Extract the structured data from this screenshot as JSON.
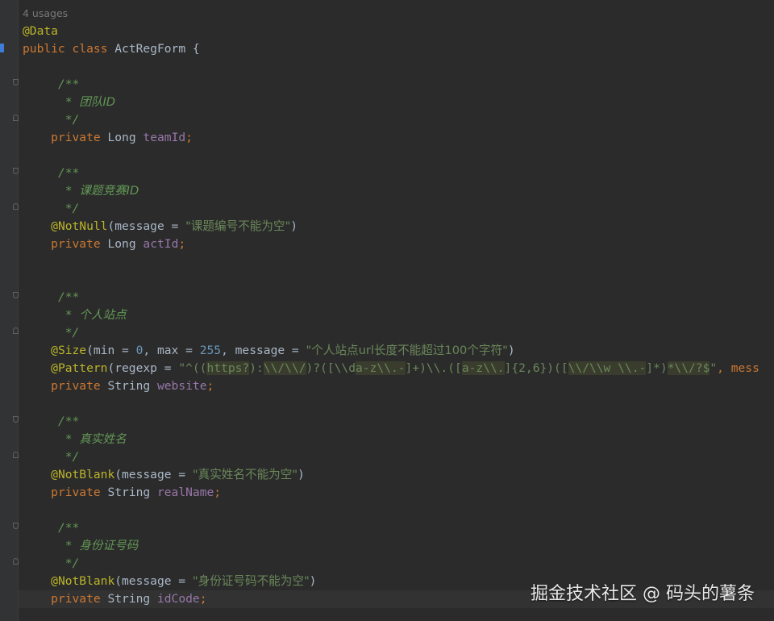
{
  "usages": "4 usages",
  "class_annotation": "@Data",
  "class_decl": {
    "kw1": "public",
    "kw2": "class",
    "name": "ActRegForm",
    "brace": "{"
  },
  "doc_open": "/**",
  "doc_close": "*/",
  "doc_star": "* ",
  "fields": [
    {
      "comment": "团队ID",
      "modifier": "private",
      "type": "Long",
      "name": "teamId"
    },
    {
      "comment": "课题竞赛ID",
      "annotation": "@NotNull",
      "ann_arg": "(message = ",
      "ann_msg": "\"课题编号不能为空\"",
      "modifier": "private",
      "type": "Long",
      "name": "actId"
    },
    {
      "comment": "个人站点",
      "modifier": "private",
      "type": "String",
      "name": "website"
    },
    {
      "comment": "真实姓名",
      "annotation": "@NotBlank",
      "ann_arg": "(message = ",
      "ann_msg": "\"真实姓名不能为空\"",
      "modifier": "private",
      "type": "String",
      "name": "realName"
    },
    {
      "comment": "身份证号码",
      "annotation": "@NotBlank",
      "ann_arg": "(message = ",
      "ann_msg": "\"身份证号码不能为空\"",
      "modifier": "private",
      "type": "String",
      "name": "idCode"
    }
  ],
  "size_ann": {
    "name": "@Size",
    "p1": "(min = ",
    "min": "0",
    "p2": ", max = ",
    "max": "255",
    "p3": ", message = ",
    "msg": "\"个人站点url长度不能超过100个字符\""
  },
  "pattern_ann": {
    "name": "@Pattern",
    "p1": "(regexp = ",
    "r1": "\"^((",
    "r2": "https?",
    "r3": "):",
    "r4": "\\\\/\\\\/",
    "r5": ")?([\\\\d",
    "r6": "a-z",
    "r7": "\\\\.-",
    "r8": "]+)\\\\.([",
    "r9": "a-z",
    "r10": "\\\\.",
    "r11": "]{2,6})([",
    "r12": "\\\\/\\\\w \\\\.-",
    "r13": "]*)",
    "r14": "*\\\\/?$",
    "r15": "\"",
    "tail": ", mess"
  },
  "close_paren": ")",
  "semicolon": ";",
  "watermark": "掘金技术社区 @ 码头的薯条"
}
